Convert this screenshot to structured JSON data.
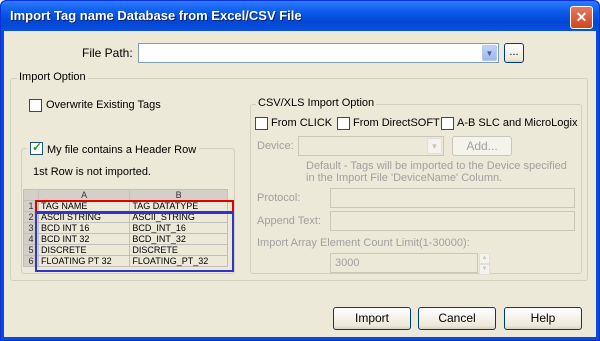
{
  "window": {
    "title": "Import Tag name Database from Excel/CSV File",
    "close_symbol": "✕"
  },
  "file_path": {
    "label": "File Path:",
    "value": "",
    "browse_label": "..."
  },
  "import_option": {
    "legend": "Import Option",
    "overwrite_label": "Overwrite Existing Tags",
    "overwrite_checked": false,
    "header_row_label": "My file contains a Header Row",
    "header_row_checked": true,
    "note": "1st Row is not imported."
  },
  "sheet": {
    "columns": [
      "A",
      "B"
    ],
    "rows": [
      {
        "n": "1",
        "a": "TAG NAME",
        "b": "TAG DATATYPE"
      },
      {
        "n": "2",
        "a": "ASCII STRING",
        "b": "ASCII_STRING"
      },
      {
        "n": "3",
        "a": "BCD INT 16",
        "b": "BCD_INT_16"
      },
      {
        "n": "4",
        "a": "BCD INT 32",
        "b": "BCD_INT_32"
      },
      {
        "n": "5",
        "a": "DISCRETE",
        "b": "DISCRETE"
      },
      {
        "n": "6",
        "a": "FLOATING PT 32",
        "b": "FLOATING_PT_32"
      }
    ]
  },
  "csv_option": {
    "legend": "CSV/XLS Import Option",
    "from_click": "From CLICK",
    "from_directsoft": "From DirectSOFT",
    "ab_slc": "A-B SLC and MicroLogix",
    "device_label": "Device:",
    "add_label": "Add...",
    "default_note_1": "Default - Tags will be imported to the Device specified",
    "default_note_2": "in the Import File 'DeviceName' Column.",
    "protocol_label": "Protocol:",
    "append_label": "Append Text:",
    "limit_label": "Import Array Element Count Limit(1-30000):",
    "limit_value": "3000"
  },
  "buttons": {
    "import": "Import",
    "cancel": "Cancel",
    "help": "Help"
  }
}
